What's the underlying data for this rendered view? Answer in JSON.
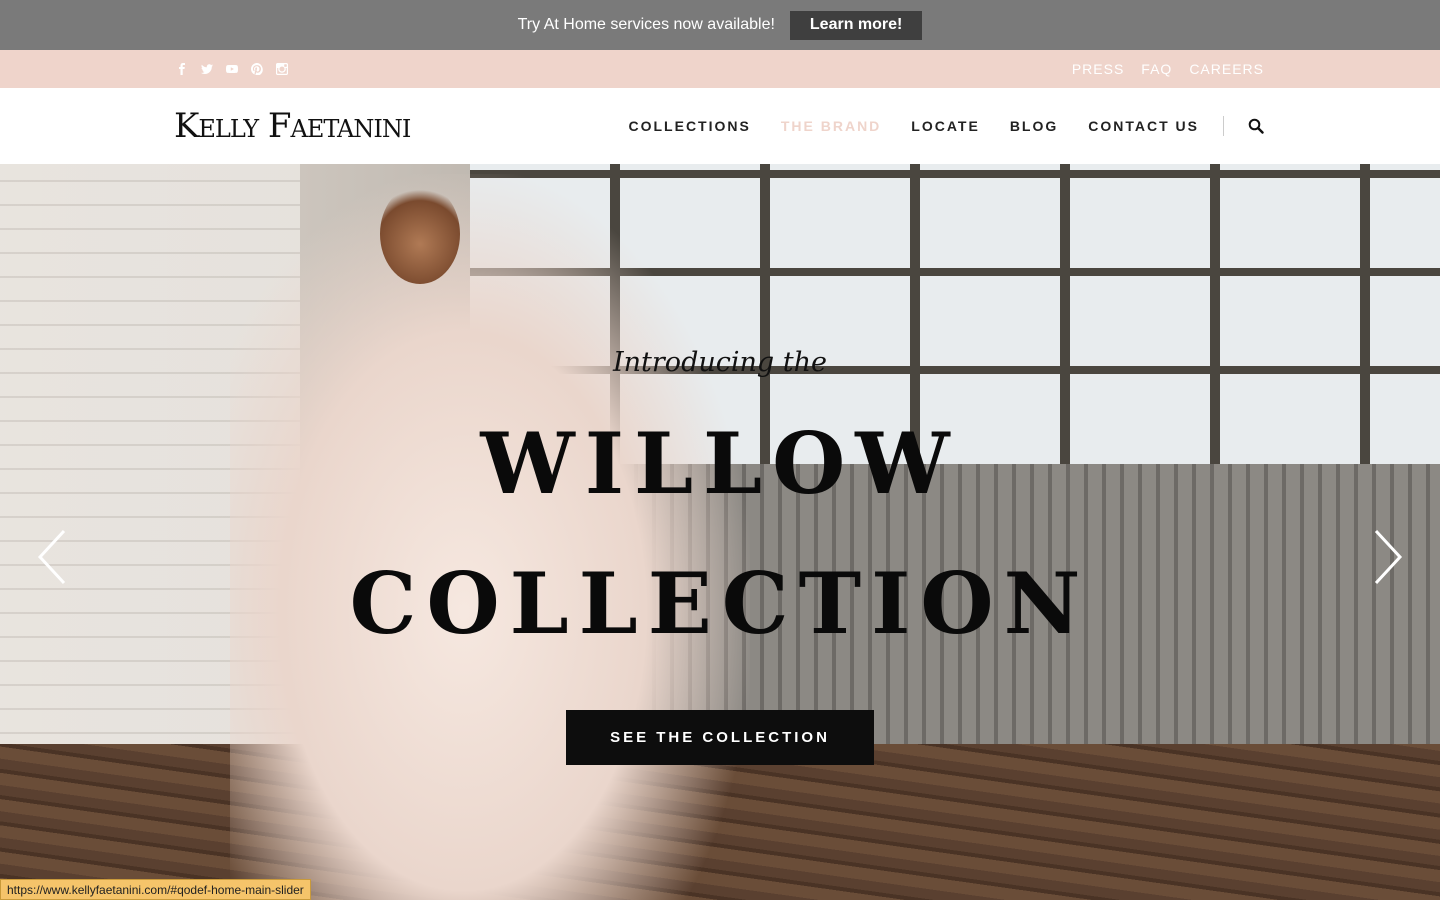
{
  "announcement": {
    "text": "Try At Home services now available!",
    "button_label": "Learn more!"
  },
  "utility": {
    "social_icons": [
      "facebook-icon",
      "twitter-icon",
      "youtube-icon",
      "pinterest-icon",
      "instagram-icon"
    ],
    "links": [
      "PRESS",
      "FAQ",
      "CAREERS"
    ]
  },
  "header": {
    "logo": "Kelly Faetanini",
    "nav": [
      "COLLECTIONS",
      "THE BRAND",
      "LOCATE",
      "BLOG",
      "CONTACT US"
    ],
    "active_nav": "THE BRAND",
    "search_icon": "search-icon"
  },
  "hero": {
    "intro": "Introducing the",
    "title_line1": "WILLOW",
    "title_line2": "COLLECTION",
    "cta_label": "SEE THE COLLECTION",
    "prev_icon": "chevron-left-icon",
    "next_icon": "chevron-right-icon"
  },
  "status_url": "https://www.kellyfaetanini.com/#qodef-home-main-slider",
  "colors": {
    "announce_bg": "#7a7a7a",
    "utility_bg": "#efd4cb",
    "active_nav": "#efd4cb",
    "cta_bg": "#0d0d0d"
  }
}
